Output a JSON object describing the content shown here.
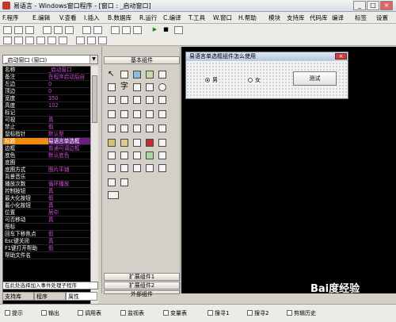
{
  "window": {
    "title": "易语言 - Windows窗口程序 - [窗口 : _启动窗口]"
  },
  "menu": {
    "items": [
      "F.程序",
      "E.编辑",
      "V.查看",
      "I.插入",
      "B.数据库",
      "R.运行",
      "C.编译",
      "T.工具",
      "W.窗口",
      "H.帮助"
    ],
    "right_items": [
      "模块",
      "支持库",
      "代码库",
      "编译",
      "标签",
      "设置"
    ]
  },
  "left_panel": {
    "combo_value": "_启动窗口 (窗口)",
    "properties": [
      {
        "name": "名称",
        "value": "_启动窗口"
      },
      {
        "name": "备注",
        "value": "在程序启动后自"
      },
      {
        "name": "左边",
        "value": "0"
      },
      {
        "name": "顶边",
        "value": "0"
      },
      {
        "name": "宽度",
        "value": "350"
      },
      {
        "name": "高度",
        "value": "102"
      },
      {
        "name": "标记",
        "value": ""
      },
      {
        "name": "可视",
        "value": "真"
      },
      {
        "name": "禁止",
        "value": "假"
      },
      {
        "name": "鼠标指针",
        "value": "默认型"
      },
      {
        "name": "标题",
        "value": "易语言单选框",
        "selected": true
      },
      {
        "name": "边框",
        "value": "普通可调边框"
      },
      {
        "name": "底色",
        "value": "默认底色"
      },
      {
        "name": "底图",
        "value": ""
      },
      {
        "name": "  底图方式",
        "value": "图片平铺"
      },
      {
        "name": "背景音乐",
        "value": ""
      },
      {
        "name": "  播放次数",
        "value": "循环播放"
      },
      {
        "name": "控制按钮",
        "value": "真"
      },
      {
        "name": "  最大化按钮",
        "value": "假"
      },
      {
        "name": "  最小化按钮",
        "value": "真"
      },
      {
        "name": "位置",
        "value": "居中"
      },
      {
        "name": "可否移动",
        "value": "真"
      },
      {
        "name": "图标",
        "value": ""
      },
      {
        "name": "回车下移焦点",
        "value": "假"
      },
      {
        "name": "Esc键关闭",
        "value": "真"
      },
      {
        "name": "F1键打开帮助",
        "value": "假"
      },
      {
        "name": "  帮助文件名",
        "value": ""
      }
    ],
    "help_text": "在此处选择加入事件处理子程序",
    "tabs": [
      "支持库",
      "程序",
      "属性"
    ]
  },
  "component_panel": {
    "header": "基本组件",
    "footer_buttons": [
      "扩展组件1",
      "扩展组件2",
      "外部组件"
    ]
  },
  "designer": {
    "form_title": "易语言单选框组件怎么使用",
    "radio1": "男",
    "radio2": "女",
    "button_label": "测试"
  },
  "watermark": "Bai度经验",
  "statusbar": {
    "items": [
      "提示",
      "输出",
      "调用表",
      "监视表",
      "变量表",
      "搜寻1",
      "搜寻2",
      "剪辑历史"
    ]
  }
}
